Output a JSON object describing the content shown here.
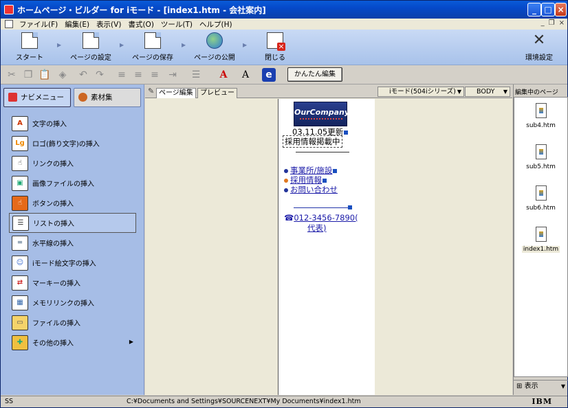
{
  "window": {
    "title": "ホームページ・ビルダー for iモード - [index1.htm - 会社案内]",
    "min": "_",
    "max": "□",
    "close": "×"
  },
  "menu": [
    "ファイル(F)",
    "編集(E)",
    "表示(V)",
    "書式(O)",
    "ツール(T)",
    "ヘルプ(H)"
  ],
  "main_toolbar": {
    "start": "スタート",
    "page_settings": "ページの設定",
    "page_save": "ページの保存",
    "page_publish": "ページの公開",
    "close": "閉じる",
    "env_settings": "環境設定"
  },
  "edit_toolbar": {
    "easy_edit": "かんたん編集"
  },
  "left_panel": {
    "tabs": [
      "ナビメニュー",
      "素材集"
    ],
    "items": [
      "文字の挿入",
      "ロゴ(飾り文字)の挿入",
      "リンクの挿入",
      "画像ファイルの挿入",
      "ボタンの挿入",
      "リストの挿入",
      "水平線の挿入",
      "iモード絵文字の挿入",
      "マーキーの挿入",
      "メモリリンクの挿入",
      "ファイルの挿入",
      "その他の挿入"
    ],
    "selected_index": 5
  },
  "editor": {
    "tabs": [
      "ページ編集",
      "プレビュー"
    ],
    "device_combo": "iモード(504iシリーズ)",
    "tag_combo": "BODY",
    "content": {
      "logo": "OurCompany",
      "date": "03.11.05更新",
      "notice": "採用情報掲載中",
      "links": [
        "事業所/施設",
        "採用情報",
        "お問い合わせ"
      ],
      "phone_line1": "012-3456-7890(",
      "phone_line2": "代表)"
    }
  },
  "right_panel": {
    "header": "編集中のページ",
    "files": [
      "sub4.htm",
      "sub5.htm",
      "sub6.htm",
      "index1.htm"
    ],
    "view_label": "表示"
  },
  "status": {
    "left": "SS",
    "path": "C:¥Documents and Settings¥SOURCENEXT¥My Documents¥index1.htm",
    "brand": "IBM"
  },
  "colors": {
    "title_bar": "#0a5bd8",
    "toolbar_bg": "#a8c2ea",
    "panel_bg": "#a6bde6",
    "link": "#1a1aa8"
  }
}
